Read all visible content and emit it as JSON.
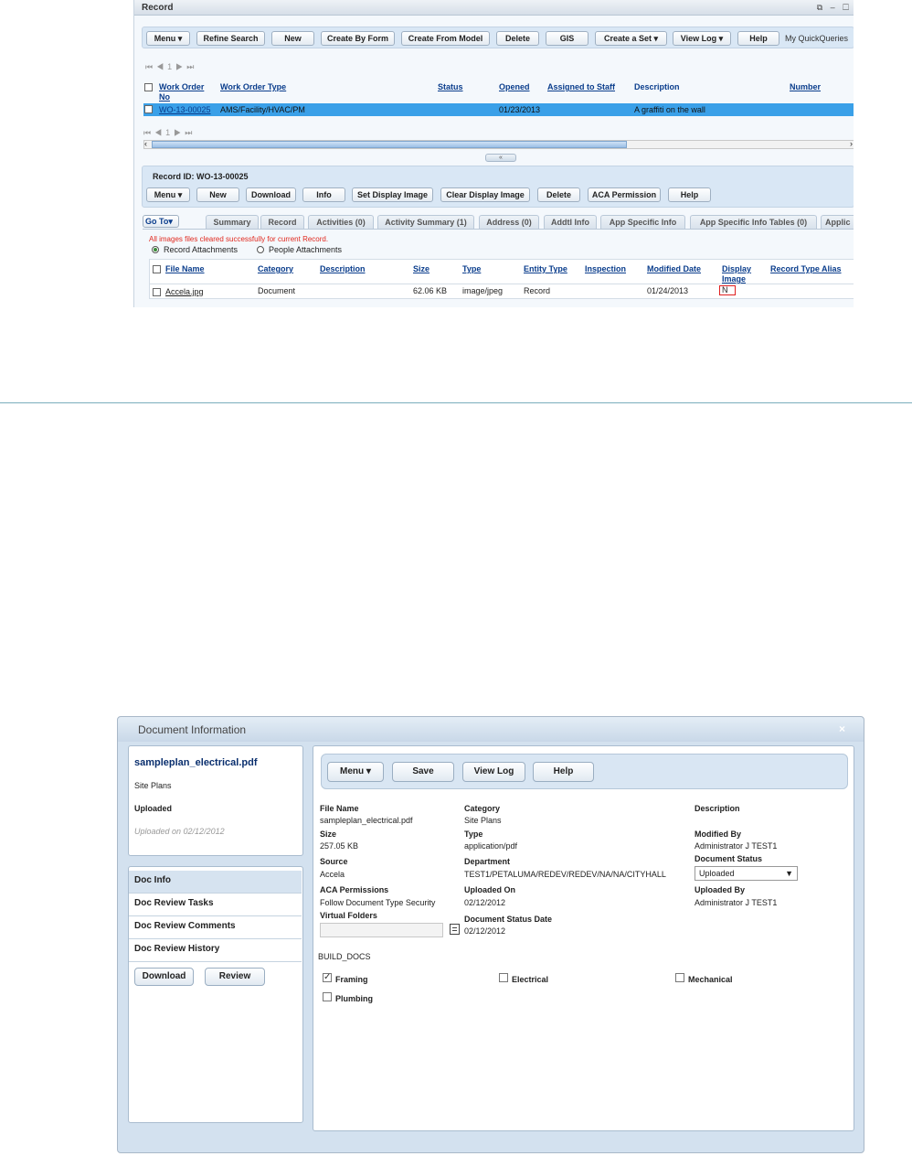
{
  "record_window": {
    "title": "Record",
    "window_icons": "⧉ – ☐",
    "toolbar": {
      "menu": "Menu",
      "refine_search": "Refine Search",
      "new": "New",
      "create_by_form": "Create By Form",
      "create_from_model": "Create From Model",
      "delete": "Delete",
      "gis": "GIS",
      "create_a_set": "Create a Set",
      "view_log": "View Log",
      "help": "Help",
      "quick_queries": "My QuickQueries"
    },
    "pager": {
      "page": "1"
    },
    "grid": {
      "headers": {
        "work_order_no": "Work Order",
        "work_order_no_2": "No",
        "work_order_type": "Work Order Type",
        "status": "Status",
        "opened": "Opened",
        "assigned_to_staff": "Assigned to Staff",
        "description": "Description",
        "number": "Number"
      },
      "row": {
        "work_order_no": "WO-13-00025",
        "work_order_type": "AMS/Facility/HVAC/PM",
        "status": "",
        "opened": "01/23/2013",
        "assigned_to_staff": "",
        "description": "A graffiti on the wall"
      }
    },
    "record_id": "Record ID: WO-13-00025",
    "detail_toolbar": {
      "menu": "Menu",
      "new": "New",
      "download": "Download",
      "info": "Info",
      "set_display_image": "Set Display Image",
      "clear_display_image": "Clear Display Image",
      "delete": "Delete",
      "aca_permission": "ACA Permission",
      "help": "Help"
    },
    "goto": "Go To",
    "tabs": [
      "Summary",
      "Record",
      "Activities (0)",
      "Activity Summary (1)",
      "Address (0)",
      "Addtl Info",
      "App Specific Info",
      "App Specific Info Tables (0)",
      "Applic"
    ],
    "message": "All images files cleared successfully for current Record.",
    "radio": {
      "record_attachments": "Record Attachments",
      "people_attachments": "People Attachments"
    },
    "attachments": {
      "headers": {
        "file_name": "File Name",
        "category": "Category",
        "description": "Description",
        "size": "Size",
        "type": "Type",
        "entity_type": "Entity Type",
        "inspection": "Inspection",
        "modified_date": "Modified Date",
        "display_image": "Display",
        "display_image_2": "Image",
        "record_type_alias": "Record Type Alias"
      },
      "row": {
        "file_name": "Accela.jpg",
        "category": "Document",
        "description": "",
        "size": "62.06 KB",
        "type": "image/jpeg",
        "entity_type": "Record",
        "inspection": "",
        "modified_date": "01/24/2013",
        "display_image": "N"
      }
    }
  },
  "doc_dialog": {
    "title": "Document Information",
    "close": "×",
    "summary": {
      "file_name": "sampleplan_electrical.pdf",
      "category": "Site Plans",
      "status": "Uploaded",
      "uploaded_on": "Uploaded on 02/12/2012"
    },
    "nav": [
      "Doc Info",
      "Doc Review Tasks",
      "Doc Review Comments",
      "Doc Review History"
    ],
    "nav_buttons": {
      "download": "Download",
      "review": "Review"
    },
    "toolbar": {
      "menu": "Menu",
      "save": "Save",
      "view_log": "View Log",
      "help": "Help"
    },
    "fields": {
      "file_name_label": "File Name",
      "file_name": "sampleplan_electrical.pdf",
      "category_label": "Category",
      "category": "Site Plans",
      "description_label": "Description",
      "size_label": "Size",
      "size": "257.05 KB",
      "type_label": "Type",
      "type": "application/pdf",
      "modified_by_label": "Modified By",
      "modified_by": "Administrator J TEST1",
      "source_label": "Source",
      "source": "Accela",
      "department_label": "Department",
      "department": "TEST1/PETALUMA/REDEV/REDEV/NA/NA/CITYHALL",
      "document_status_label": "Document Status",
      "document_status": "Uploaded",
      "aca_permissions_label": "ACA Permissions",
      "aca_permissions": "Follow Document Type Security",
      "uploaded_on_label": "Uploaded On",
      "uploaded_on": "02/12/2012",
      "uploaded_by_label": "Uploaded By",
      "uploaded_by": "Administrator J TEST1",
      "virtual_folders_label": "Virtual Folders",
      "virtual_folders": "",
      "document_status_date_label": "Document Status Date",
      "document_status_date": "02/12/2012"
    },
    "group_label": "BUILD_DOCS",
    "checkboxes": [
      {
        "label": "Framing",
        "checked": true
      },
      {
        "label": "Electrical",
        "checked": false
      },
      {
        "label": "Mechanical",
        "checked": false
      },
      {
        "label": "Plumbing",
        "checked": false
      }
    ]
  }
}
